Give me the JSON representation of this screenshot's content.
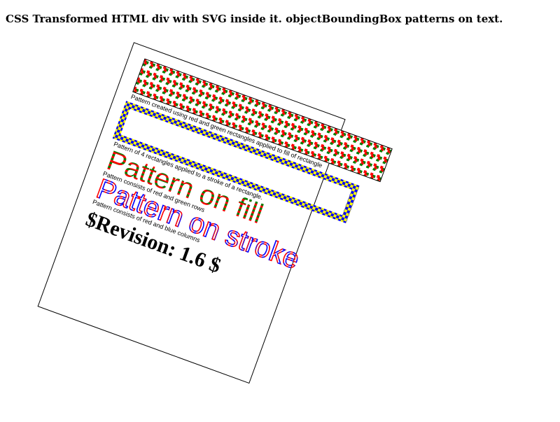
{
  "heading": "CSS Transformed HTML div with SVG inside it. objectBoundingBox patterns on text.",
  "svg": {
    "caption_fill_rect": "Pattern created using red and green rectangles applied to fill of rectangle",
    "caption_stroke_rect": "Pattern of 4 rectangles applied to a stroke of a rectangle.",
    "text_fill": "Pattern on fill",
    "caption_text_fill": "Pattern consists of red and green rows",
    "text_stroke": "Pattern on stroke",
    "caption_text_stroke": "Pattern consists of red and blue columns",
    "revision": "$Revision: 1.6 $"
  },
  "colors": {
    "red": "#ff0000",
    "green": "#008000",
    "blue": "#0000ff",
    "yellow": "#ffff00"
  }
}
